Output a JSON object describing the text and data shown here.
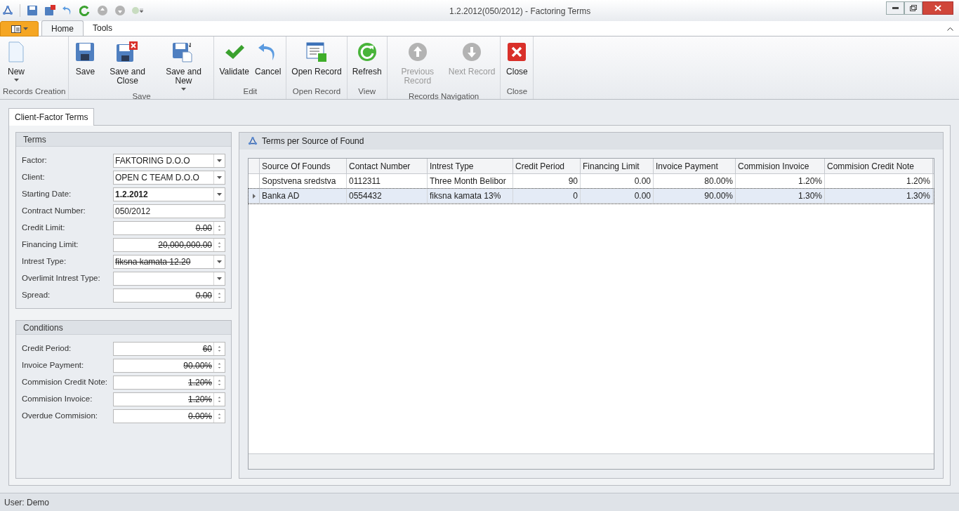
{
  "window": {
    "title": "1.2.2012(050/2012) - Factoring Terms"
  },
  "ribbon_tabs": [
    {
      "label": "Home",
      "selected": true
    },
    {
      "label": "Tools",
      "selected": false
    }
  ],
  "ribbon_groups": [
    {
      "label": "Records Creation",
      "buttons": [
        {
          "kind": "new",
          "label": "New",
          "has_menu": true,
          "disabled": false
        }
      ]
    },
    {
      "label": "Save",
      "buttons": [
        {
          "kind": "save",
          "label": "Save",
          "has_menu": false,
          "disabled": false
        },
        {
          "kind": "save_close",
          "label": "Save and Close",
          "has_menu": false,
          "disabled": false
        },
        {
          "kind": "save_new",
          "label": "Save and New",
          "has_menu": true,
          "disabled": false
        }
      ]
    },
    {
      "label": "Edit",
      "buttons": [
        {
          "kind": "validate",
          "label": "Validate",
          "has_menu": false,
          "disabled": false
        },
        {
          "kind": "cancel",
          "label": "Cancel",
          "has_menu": false,
          "disabled": false
        }
      ]
    },
    {
      "label": "Open Record",
      "buttons": [
        {
          "kind": "open",
          "label": "Open Record",
          "has_menu": false,
          "disabled": false
        }
      ]
    },
    {
      "label": "View",
      "buttons": [
        {
          "kind": "refresh",
          "label": "Refresh",
          "has_menu": false,
          "disabled": false
        }
      ]
    },
    {
      "label": "Records Navigation",
      "buttons": [
        {
          "kind": "previous",
          "label": "Previous Record",
          "has_menu": false,
          "disabled": true
        },
        {
          "kind": "next",
          "label": "Next Record",
          "has_menu": false,
          "disabled": true
        }
      ]
    },
    {
      "label": "Close",
      "buttons": [
        {
          "kind": "close",
          "label": "Close",
          "has_menu": false,
          "disabled": false
        }
      ]
    }
  ],
  "page_tab": {
    "label": "Client-Factor Terms"
  },
  "terms": {
    "title": "Terms",
    "fields": [
      {
        "label": "Factor:",
        "kind": "combo",
        "value": "FAKTORING D.O.O",
        "struck": false,
        "bold": false
      },
      {
        "label": "Client:",
        "kind": "combo",
        "value": "OPEN C TEAM D.O.O",
        "struck": false,
        "bold": false
      },
      {
        "label": "Starting Date:",
        "kind": "combo",
        "value": "1.2.2012",
        "struck": false,
        "bold": true
      },
      {
        "label": "Contract Number:",
        "kind": "text",
        "value": "050/2012",
        "struck": false,
        "bold": false
      },
      {
        "label": "Credit Limit:",
        "kind": "spin",
        "value": "0.00",
        "struck": true,
        "bold": false
      },
      {
        "label": "Financing Limit:",
        "kind": "spin",
        "value": "20,000,000.00",
        "struck": true,
        "bold": false
      },
      {
        "label": "Intrest Type:",
        "kind": "combo",
        "value": "fiksna kamata 12.20",
        "struck": true,
        "bold": false
      },
      {
        "label": "Overlimit Intrest Type:",
        "kind": "combo"
      },
      {
        "label": "Spread:",
        "kind": "spin",
        "value": "0.00",
        "struck": true,
        "bold": false
      }
    ]
  },
  "conditions": {
    "title": "Conditions",
    "fields": [
      {
        "label": "Credit Period:",
        "kind": "spin",
        "value": "60",
        "struck": true,
        "bold": false
      },
      {
        "label": "Invoice Payment:",
        "kind": "spin",
        "value": "90.00%",
        "struck": true,
        "bold": false
      },
      {
        "label": "Commision Credit Note:",
        "kind": "spin",
        "value": "1.20%",
        "struck": true,
        "bold": false
      },
      {
        "label": "Commision Invoice:",
        "kind": "spin",
        "value": "1.20%",
        "struck": true,
        "bold": false
      },
      {
        "label": "Overdue Commision:",
        "kind": "spin",
        "value": "0.00%",
        "struck": true,
        "bold": false
      }
    ]
  },
  "grid_panel": {
    "title": "Terms per Source of Found",
    "columns": [
      {
        "label": "Source Of Founds"
      },
      {
        "label": "Contact Number"
      },
      {
        "label": "Intrest Type"
      },
      {
        "label": "Credit Period"
      },
      {
        "label": "Financing Limit"
      },
      {
        "label": "Invoice Payment"
      },
      {
        "label": "Commision Invoice"
      },
      {
        "label": "Commision Credit Note"
      }
    ],
    "rows": [
      {
        "selected": false,
        "cells": [
          "Sopstvena sredstva",
          "0112311",
          "Three Month Belibor",
          "90",
          "0.00",
          "80.00%",
          "1.20%",
          "1.20%"
        ]
      },
      {
        "selected": true,
        "cells": [
          "Banka AD",
          "0554432",
          "fiksna kamata 13%",
          "0",
          "0.00",
          "90.00%",
          "1.30%",
          "1.30%"
        ]
      }
    ]
  },
  "status_bar": {
    "text": "User: Demo"
  }
}
